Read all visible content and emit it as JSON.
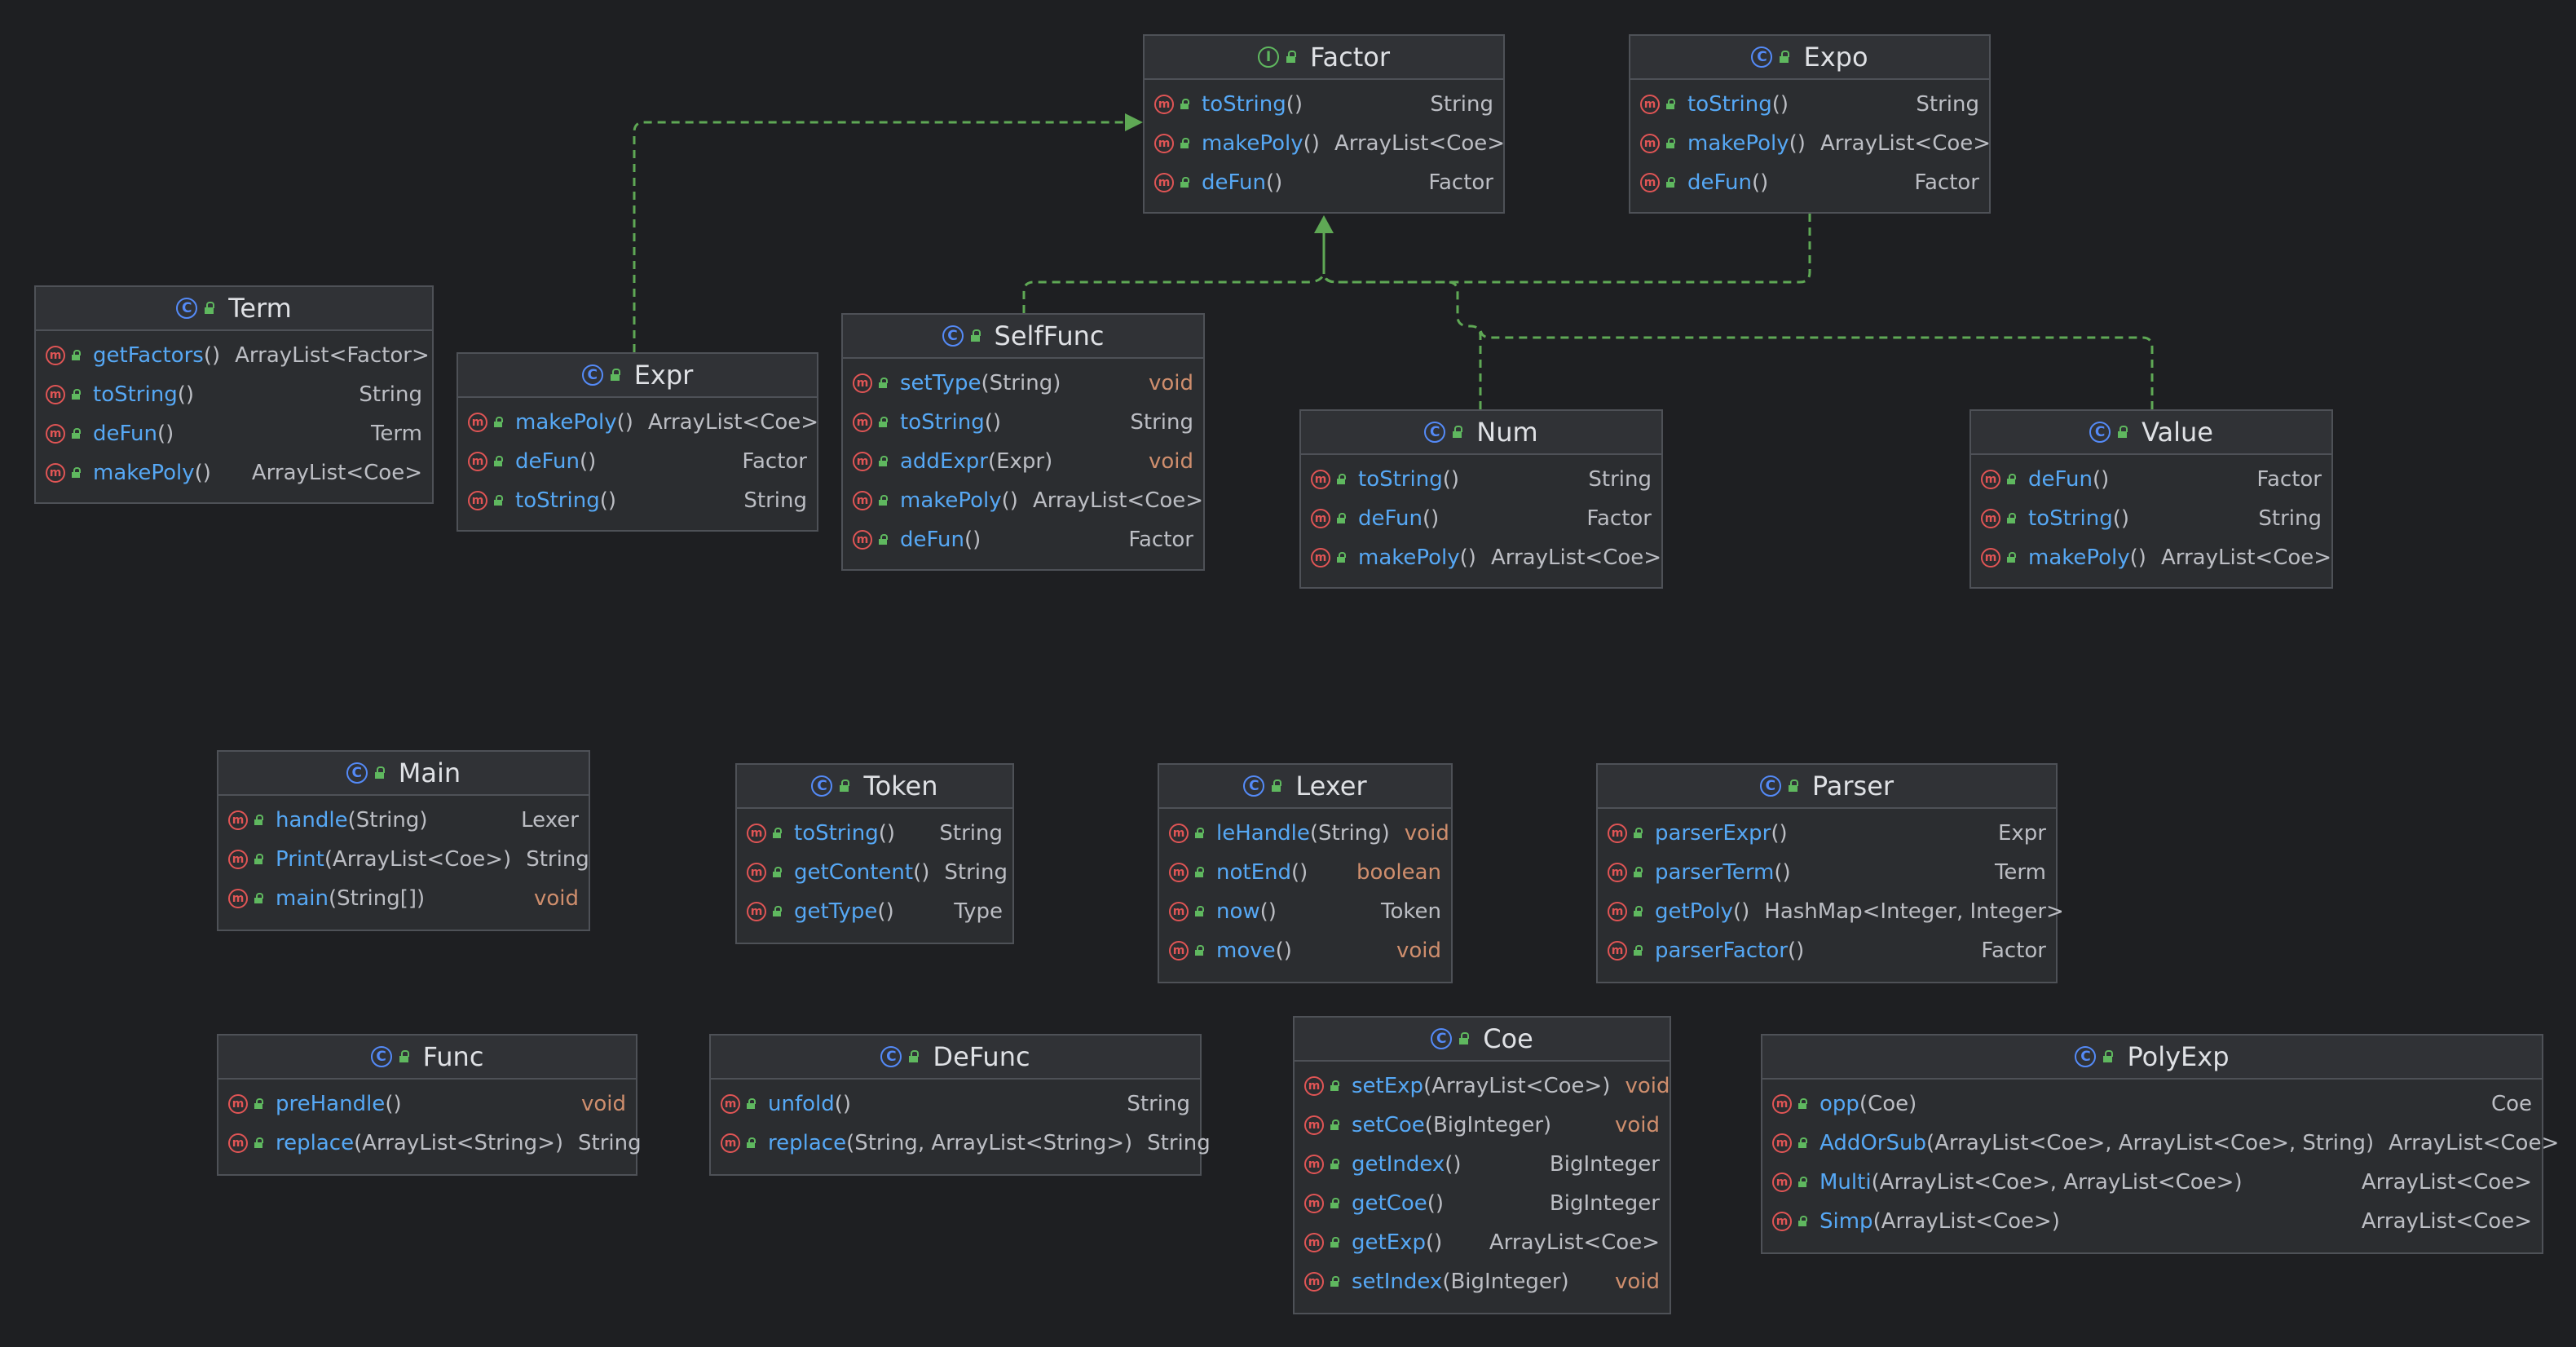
{
  "colors": {
    "background": "#1e1f22",
    "node": "#2b2d30",
    "border": "#4e5157",
    "method": "#56a8f5",
    "keyword_type": "#cf8e6d",
    "edge": "#5fa855",
    "class_icon": "#548af7",
    "method_icon": "#e05555"
  },
  "nodes": [
    {
      "id": "Factor",
      "kind": "interface",
      "icon": "interface-icon",
      "methods": [
        {
          "name": "toString",
          "params": "()",
          "ret": "String"
        },
        {
          "name": "makePoly",
          "params": "()",
          "ret": "ArrayList<Coe>"
        },
        {
          "name": "deFun",
          "params": "()",
          "ret": "Factor"
        }
      ]
    },
    {
      "id": "Expo",
      "kind": "class",
      "icon": "class-icon",
      "methods": [
        {
          "name": "toString",
          "params": "()",
          "ret": "String"
        },
        {
          "name": "makePoly",
          "params": "()",
          "ret": "ArrayList<Coe>"
        },
        {
          "name": "deFun",
          "params": "()",
          "ret": "Factor"
        }
      ]
    },
    {
      "id": "Term",
      "kind": "class",
      "icon": "class-icon",
      "methods": [
        {
          "name": "getFactors",
          "params": "()",
          "ret": "ArrayList<Factor>"
        },
        {
          "name": "toString",
          "params": "()",
          "ret": "String"
        },
        {
          "name": "deFun",
          "params": "()",
          "ret": "Term"
        },
        {
          "name": "makePoly",
          "params": "()",
          "ret": "ArrayList<Coe>"
        }
      ]
    },
    {
      "id": "Expr",
      "kind": "class",
      "icon": "class-icon",
      "methods": [
        {
          "name": "makePoly",
          "params": "()",
          "ret": "ArrayList<Coe>"
        },
        {
          "name": "deFun",
          "params": "()",
          "ret": "Factor"
        },
        {
          "name": "toString",
          "params": "()",
          "ret": "String"
        }
      ]
    },
    {
      "id": "SelfFunc",
      "kind": "class",
      "icon": "class-icon",
      "methods": [
        {
          "name": "setType",
          "params": "(String)",
          "ret": "void"
        },
        {
          "name": "toString",
          "params": "()",
          "ret": "String"
        },
        {
          "name": "addExpr",
          "params": "(Expr)",
          "ret": "void"
        },
        {
          "name": "makePoly",
          "params": "()",
          "ret": "ArrayList<Coe>"
        },
        {
          "name": "deFun",
          "params": "()",
          "ret": "Factor"
        }
      ]
    },
    {
      "id": "Num",
      "kind": "class",
      "icon": "class-icon",
      "methods": [
        {
          "name": "toString",
          "params": "()",
          "ret": "String"
        },
        {
          "name": "deFun",
          "params": "()",
          "ret": "Factor"
        },
        {
          "name": "makePoly",
          "params": "()",
          "ret": "ArrayList<Coe>"
        }
      ]
    },
    {
      "id": "Value",
      "kind": "class",
      "icon": "class-icon",
      "methods": [
        {
          "name": "deFun",
          "params": "()",
          "ret": "Factor"
        },
        {
          "name": "toString",
          "params": "()",
          "ret": "String"
        },
        {
          "name": "makePoly",
          "params": "()",
          "ret": "ArrayList<Coe>"
        }
      ]
    },
    {
      "id": "Main",
      "kind": "class",
      "icon": "class-icon",
      "methods": [
        {
          "name": "handle",
          "params": "(String)",
          "ret": "Lexer"
        },
        {
          "name": "Print",
          "params": "(ArrayList<Coe>)",
          "ret": "String"
        },
        {
          "name": "main",
          "params": "(String[])",
          "ret": "void"
        }
      ]
    },
    {
      "id": "Token",
      "kind": "class",
      "icon": "class-icon",
      "methods": [
        {
          "name": "toString",
          "params": "()",
          "ret": "String"
        },
        {
          "name": "getContent",
          "params": "()",
          "ret": "String"
        },
        {
          "name": "getType",
          "params": "()",
          "ret": "Type"
        }
      ]
    },
    {
      "id": "Lexer",
      "kind": "class",
      "icon": "class-icon",
      "methods": [
        {
          "name": "leHandle",
          "params": "(String)",
          "ret": "void"
        },
        {
          "name": "notEnd",
          "params": "()",
          "ret": "boolean"
        },
        {
          "name": "now",
          "params": "()",
          "ret": "Token"
        },
        {
          "name": "move",
          "params": "()",
          "ret": "void"
        }
      ]
    },
    {
      "id": "Parser",
      "kind": "class",
      "icon": "class-icon",
      "methods": [
        {
          "name": "parserExpr",
          "params": "()",
          "ret": "Expr"
        },
        {
          "name": "parserTerm",
          "params": "()",
          "ret": "Term"
        },
        {
          "name": "getPoly",
          "params": "()",
          "ret": "HashMap<Integer, Integer>"
        },
        {
          "name": "parserFactor",
          "params": "()",
          "ret": "Factor"
        }
      ]
    },
    {
      "id": "Func",
      "kind": "class",
      "icon": "class-icon",
      "methods": [
        {
          "name": "preHandle",
          "params": "()",
          "ret": "void"
        },
        {
          "name": "replace",
          "params": "(ArrayList<String>)",
          "ret": "String"
        }
      ]
    },
    {
      "id": "DeFunc",
      "kind": "class",
      "icon": "class-icon",
      "methods": [
        {
          "name": "unfold",
          "params": "()",
          "ret": "String"
        },
        {
          "name": "replace",
          "params": "(String, ArrayList<String>)",
          "ret": "String"
        }
      ]
    },
    {
      "id": "Coe",
      "kind": "class",
      "icon": "class-icon",
      "methods": [
        {
          "name": "setExp",
          "params": "(ArrayList<Coe>)",
          "ret": "void"
        },
        {
          "name": "setCoe",
          "params": "(BigInteger)",
          "ret": "void"
        },
        {
          "name": "getIndex",
          "params": "()",
          "ret": "BigInteger"
        },
        {
          "name": "getCoe",
          "params": "()",
          "ret": "BigInteger"
        },
        {
          "name": "getExp",
          "params": "()",
          "ret": "ArrayList<Coe>"
        },
        {
          "name": "setIndex",
          "params": "(BigInteger)",
          "ret": "void"
        }
      ]
    },
    {
      "id": "PolyExp",
      "kind": "class",
      "icon": "class-icon",
      "methods": [
        {
          "name": "opp",
          "params": "(Coe)",
          "ret": "Coe"
        },
        {
          "name": "AddOrSub",
          "params": "(ArrayList<Coe>, ArrayList<Coe>, String)",
          "ret": "ArrayList<Coe>"
        },
        {
          "name": "Multi",
          "params": "(ArrayList<Coe>, ArrayList<Coe>)",
          "ret": "ArrayList<Coe>"
        },
        {
          "name": "Simp",
          "params": "(ArrayList<Coe>)",
          "ret": "ArrayList<Coe>"
        }
      ]
    }
  ],
  "edges": [
    {
      "from": "Expr",
      "to": "Factor",
      "type": "implements"
    },
    {
      "from": "SelfFunc",
      "to": "Factor",
      "type": "implements"
    },
    {
      "from": "Expo",
      "to": "Factor",
      "type": "implements"
    },
    {
      "from": "Num",
      "to": "Factor",
      "type": "implements"
    },
    {
      "from": "Value",
      "to": "Factor",
      "type": "implements"
    }
  ]
}
